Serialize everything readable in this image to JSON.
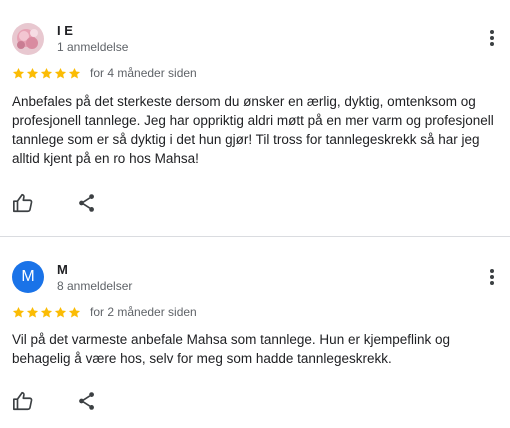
{
  "reviews": [
    {
      "author": "I E",
      "meta": "1 anmeldelse",
      "avatar_type": "photo",
      "rating": 5,
      "date": "for 4 måneder siden",
      "text": "Anbefales på det sterkeste dersom du ønsker en ærlig, dyktig, omtenksom og profesjonell tannlege. Jeg har oppriktig aldri møtt på en mer varm og profesjonell tannlege som er så dyktig i det hun gjør! Til tross for tannlegeskrekk så har jeg alltid kjent på en ro hos Mahsa!"
    },
    {
      "author": "M",
      "meta": "8 anmeldelser",
      "avatar_type": "initial",
      "avatar_letter": "M",
      "avatar_color": "#1a73e8",
      "rating": 5,
      "date": "for 2 måneder siden",
      "text": "Vil på det varmeste anbefale Mahsa som tannlege. Hun er kjempeflink og behagelig å være hos, selv for meg som hadde tannlegeskrekk."
    }
  ],
  "icons": {
    "star": "star-icon",
    "like": "thumbs-up-icon",
    "share": "share-icon",
    "more": "more-vert-icon"
  },
  "colors": {
    "star": "#fbbc04",
    "text": "#202124",
    "secondary": "#5f6368",
    "divider": "#dadce0"
  }
}
